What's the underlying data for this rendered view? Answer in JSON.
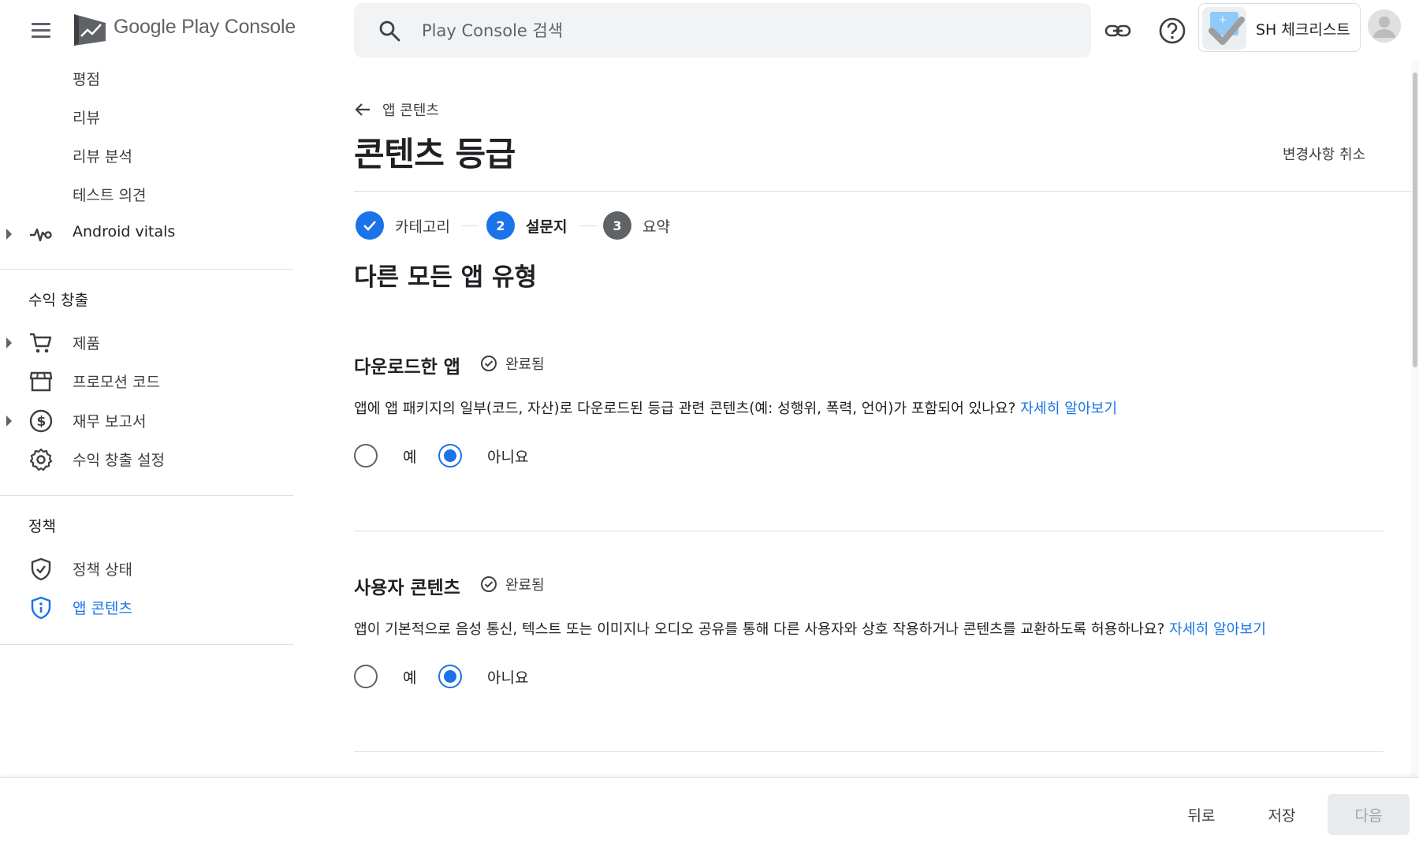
{
  "header": {
    "brand": "Google Play Console",
    "search_placeholder": "Play Console 검색",
    "app_name": "SH 체크리스트"
  },
  "sidebar": {
    "items_top": [
      {
        "label": "평점"
      },
      {
        "label": "리뷰"
      },
      {
        "label": "리뷰 분석"
      },
      {
        "label": "테스트 의견"
      }
    ],
    "vitals": {
      "label": "Android vitals"
    },
    "monetize_section": "수익 창출",
    "monetize_items": [
      {
        "label": "제품"
      },
      {
        "label": "프로모션 코드"
      },
      {
        "label": "재무 보고서"
      },
      {
        "label": "수익 창출 설정"
      }
    ],
    "policy_section": "정책",
    "policy_items": [
      {
        "label": "정책 상태"
      },
      {
        "label": "앱 콘텐츠"
      }
    ]
  },
  "page": {
    "back_label": "앱 콘텐츠",
    "title": "콘텐츠 등급",
    "discard_label": "변경사항 취소",
    "section_heading": "다른 모든 앱 유형"
  },
  "stepper": {
    "steps": [
      {
        "number": "",
        "label": "카테고리",
        "state": "done"
      },
      {
        "number": "2",
        "label": "설문지",
        "state": "current"
      },
      {
        "number": "3",
        "label": "요약",
        "state": "todo"
      }
    ]
  },
  "questions": [
    {
      "title": "다운로드한 앱",
      "status": "완료됨",
      "text": "앱에 앱 패키지의 일부(코드, 자산)로 다운로드된 등급 관련 콘텐츠(예: 성행위, 폭력, 언어)가 포함되어 있나요?",
      "link": "자세히 알아보기",
      "options": [
        "예",
        "아니요"
      ],
      "selected": "아니요"
    },
    {
      "title": "사용자 콘텐츠",
      "status": "완료됨",
      "text": "앱이 기본적으로 음성 통신, 텍스트 또는 이미지나 오디오 공유를 통해 다른 사용자와 상호 작용하거나 콘텐츠를 교환하도록 허용하나요?",
      "link": "자세히 알아보기",
      "options": [
        "예",
        "아니요"
      ],
      "selected": "아니요"
    }
  ],
  "footer": {
    "back_label": "뒤로",
    "save_label": "저장",
    "next_label": "다음"
  },
  "colors": {
    "accent": "#1a73e8",
    "text": "#202124",
    "muted": "#5f6368"
  }
}
